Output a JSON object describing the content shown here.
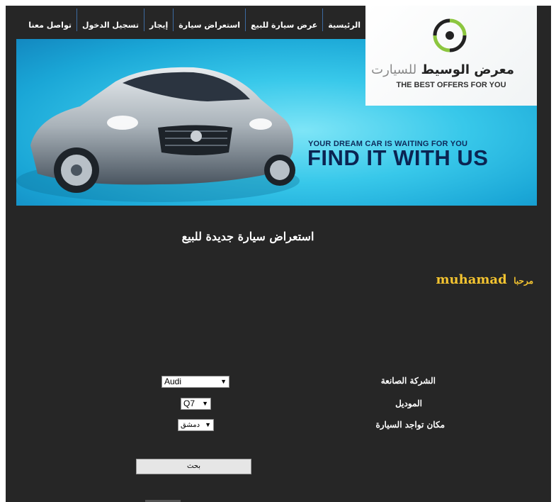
{
  "nav": {
    "items": [
      "الرئيسية",
      "عرض سيارة للبيع",
      "استعراض سيارة",
      "إيجار",
      "تسجيل الدخول",
      "تواصل معنا"
    ]
  },
  "logo": {
    "title_dark": "معرض الوسيط",
    "title_light": "للسيارت",
    "subtitle": "THE BEST OFFERS FOR YOU",
    "colors": {
      "ring_green": "#8cc63f",
      "ring_dark": "#222222"
    }
  },
  "banner": {
    "slogan_small": "YOUR DREAM CAR IS WAITING FOR YOU",
    "slogan_big": "FIND IT WITH US"
  },
  "page": {
    "title": "استعراض سيارة جديدة للبيع",
    "welcome_word": "مرحبا",
    "username": "muhamad"
  },
  "form": {
    "manufacturer_label": "الشركة الصانعة",
    "manufacturer_value": "Audi",
    "model_label": "الموديل",
    "model_value": "Q7",
    "location_label": "مكان تواجد السيارة",
    "location_value": "دمشق",
    "search_label": "بحث"
  },
  "colors": {
    "background": "#262626",
    "accent_yellow": "#f4c430",
    "banner_cyan": "#38c8ea"
  }
}
